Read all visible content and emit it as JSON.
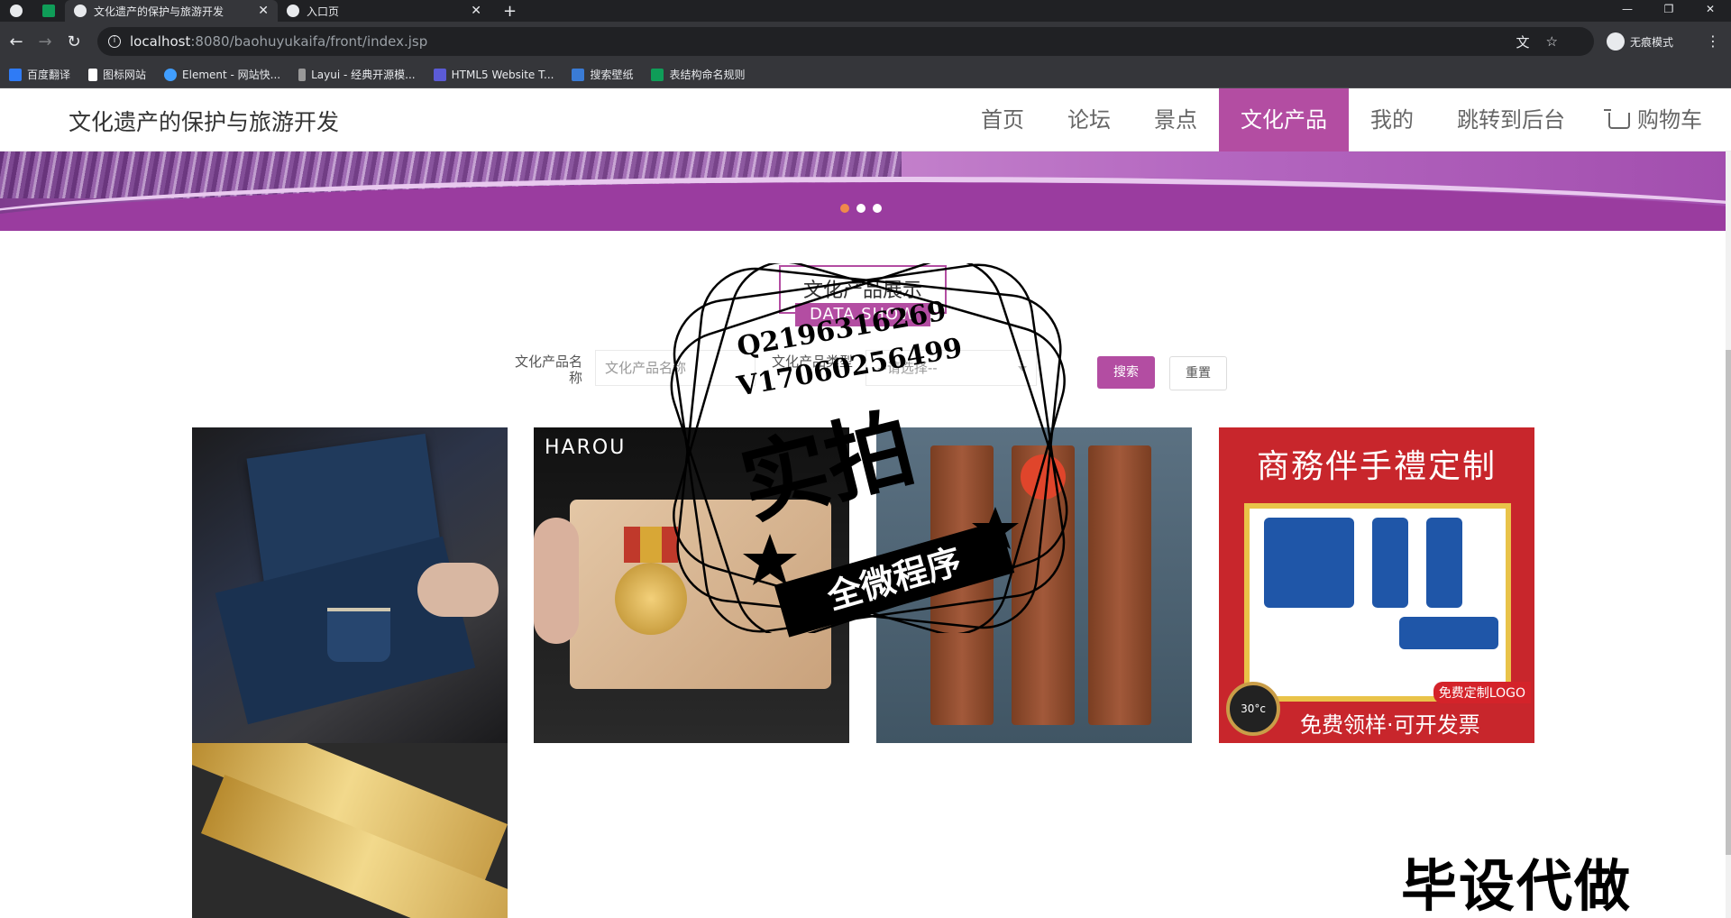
{
  "browser": {
    "tabs": [
      {
        "title": "文化遗产的保护与旅游开发",
        "close": "✕"
      },
      {
        "title": "入口页",
        "close": "✕"
      }
    ],
    "new_tab": "+",
    "window_controls": [
      "—",
      "❐",
      "✕"
    ],
    "url_host": "localhost",
    "url_path": ":8080/baohuyukaifa/front/index.jsp",
    "incognito_label": "无痕模式",
    "bookmarks": [
      {
        "label": "百度翻译",
        "color": "#2f7bf5"
      },
      {
        "label": "图标网站",
        "color": "#ffffff"
      },
      {
        "label": "Element - 网站快...",
        "color": "#409eff"
      },
      {
        "label": "Layui - 经典开源模...",
        "color": "#999999"
      },
      {
        "label": "HTML5 Website T...",
        "color": "#5b5bd6"
      },
      {
        "label": "搜索壁纸",
        "color": "#3a7bd5"
      },
      {
        "label": "表结构命名规则",
        "color": "#0f9d58"
      }
    ]
  },
  "site": {
    "title": "文化遗产的保护与旅游开发",
    "nav": [
      {
        "label": "首页",
        "active": false
      },
      {
        "label": "论坛",
        "active": false
      },
      {
        "label": "景点",
        "active": false
      },
      {
        "label": "文化产品",
        "active": true
      },
      {
        "label": "我的",
        "active": false
      },
      {
        "label": "跳转到后台",
        "active": false
      },
      {
        "label": "购物车",
        "active": false
      }
    ],
    "accent_color": "#b34da2"
  },
  "section": {
    "title": "文化产品展示",
    "subtitle": "DATA SHOW"
  },
  "search": {
    "name_label": "文化产品名称",
    "name_placeholder": "文化产品名称",
    "type_label": "文化产品类型",
    "type_selected": "--请选择--",
    "search_button": "搜索",
    "reset_button": "重置"
  },
  "products": [
    {
      "image": "tea-set-gift-box"
    },
    {
      "image": "award-plaque-medal",
      "brand_text": "HAROU"
    },
    {
      "image": "wooden-bookmarks"
    },
    {
      "image": "business-gift-set",
      "headline": "商務伴手禮定制",
      "badge": "免费定制LOGO",
      "footer": "免费领样·可开发票",
      "clock_text": "30°c"
    },
    {
      "image": "gold-bookmarks"
    }
  ],
  "watermark": {
    "line1": "Q2196316269",
    "line2": "V17060256499",
    "big": "实拍",
    "band": "全微程序",
    "corner": "毕设代做"
  }
}
